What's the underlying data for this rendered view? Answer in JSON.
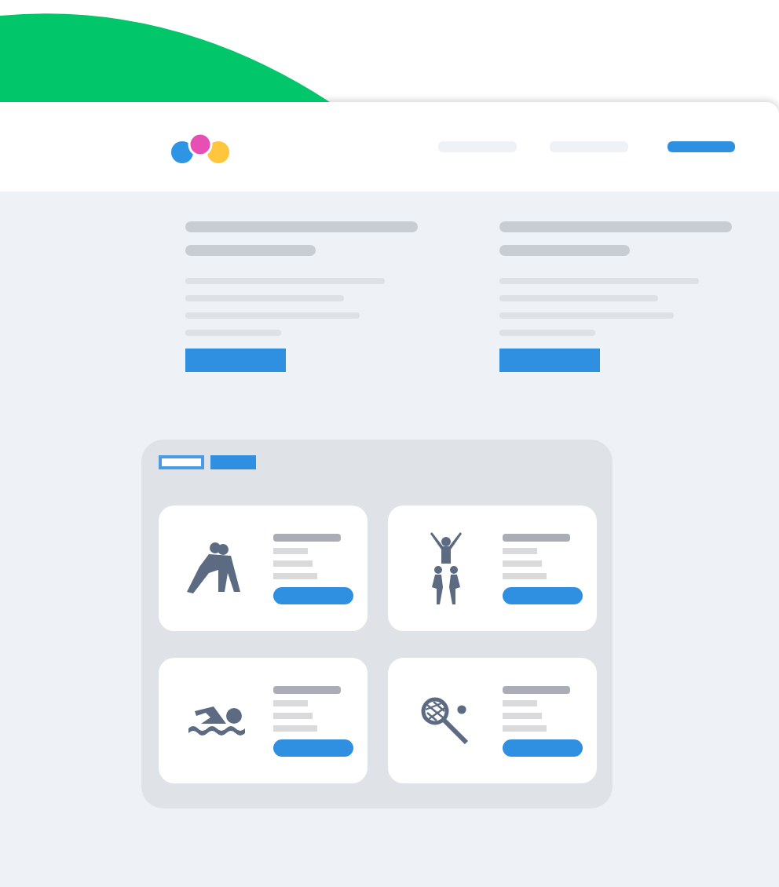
{
  "nav": {
    "items": [
      {
        "selected": false
      },
      {
        "selected": false
      },
      {
        "selected": true
      }
    ]
  },
  "hero_columns": [
    {
      "kind": "text-block"
    },
    {
      "kind": "text-block"
    }
  ],
  "panel": {
    "tabs": [
      {
        "selected": false
      },
      {
        "selected": true
      }
    ],
    "cards": [
      {
        "kind": "wrestling"
      },
      {
        "kind": "cheer"
      },
      {
        "kind": "swimming"
      },
      {
        "kind": "tennis"
      }
    ]
  }
}
